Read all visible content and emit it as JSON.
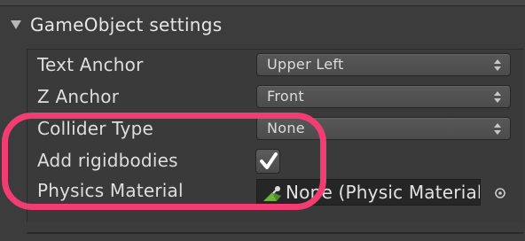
{
  "section": {
    "title": "GameObject settings"
  },
  "rows": {
    "text_anchor": {
      "label": "Text Anchor",
      "value": "Upper Left"
    },
    "z_anchor": {
      "label": "Z Anchor",
      "value": "Front"
    },
    "collider_type": {
      "label": "Collider Type",
      "value": "None"
    },
    "add_rigidbodies": {
      "label": "Add rigidbodies",
      "checked": true
    },
    "physics_material": {
      "label": "Physics Material",
      "value": "None (Physic Material)"
    }
  },
  "colors": {
    "highlight": "#f23c74",
    "background": "#3c3c3c"
  },
  "icons": {
    "foldout": "triangle-down-icon",
    "dropdown": "up-down-arrows-icon",
    "checkbox": "checkmark-icon",
    "physics_material": "physic-material-icon",
    "object_picker": "object-picker-icon"
  }
}
